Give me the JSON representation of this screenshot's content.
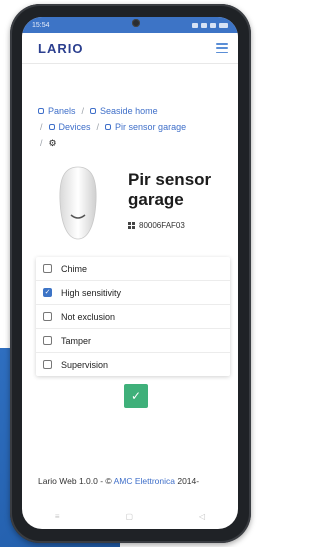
{
  "status_bar": {
    "time": "15:54"
  },
  "app": {
    "logo": "LARIO"
  },
  "breadcrumb": {
    "items": [
      {
        "label": "Panels"
      },
      {
        "label": "Seaside home"
      },
      {
        "label": "Devices"
      },
      {
        "label": "Pir sensor garage"
      }
    ],
    "separator": "/"
  },
  "device": {
    "name": "Pir sensor garage",
    "id": "80006FAF03"
  },
  "options": [
    {
      "label": "Chime",
      "checked": false
    },
    {
      "label": "High sensitivity",
      "checked": true
    },
    {
      "label": "Not exclusion",
      "checked": false
    },
    {
      "label": "Tamper",
      "checked": false
    },
    {
      "label": "Supervision",
      "checked": false
    }
  ],
  "footer": {
    "prefix": "Lario Web 1.0.0 - © ",
    "link": "AMC Elettronica",
    "suffix": " 2014-"
  },
  "colors": {
    "status_bar": "#3d74c6",
    "link": "#3f6fc9",
    "save_button": "#3fb07a",
    "logo": "#2b3f8f"
  }
}
